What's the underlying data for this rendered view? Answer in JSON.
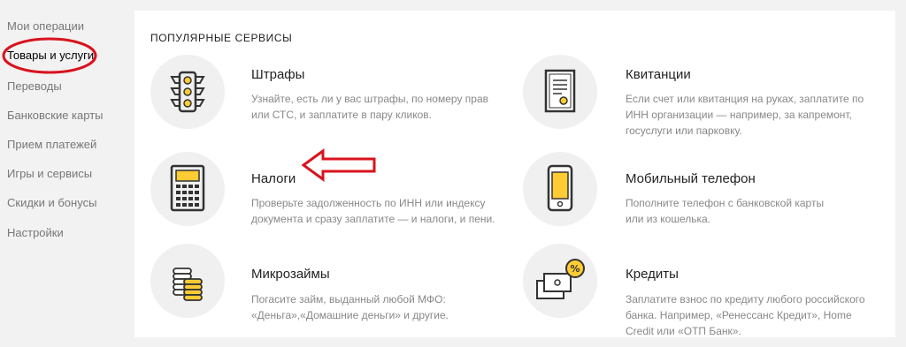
{
  "sidebar": {
    "items": [
      {
        "label": "Мои операции"
      },
      {
        "label": "Товары и услуги"
      },
      {
        "label": "Переводы"
      },
      {
        "label": "Банковские карты"
      },
      {
        "label": "Прием платежей"
      },
      {
        "label": "Игры и сервисы"
      },
      {
        "label": "Скидки и бонусы"
      },
      {
        "label": "Настройки"
      }
    ]
  },
  "main": {
    "section_title": "ПОПУЛЯРНЫЕ СЕРВИСЫ",
    "services": [
      {
        "title": "Штрафы",
        "icon": "traffic-light-icon",
        "desc": [
          "Узнайте, есть ли у вас штрафы, по номеру прав",
          "или СТС, и заплатите в пару кликов."
        ]
      },
      {
        "title": "Квитанции",
        "icon": "receipt-document-icon",
        "desc": [
          "Если счет или квитанция на руках, заплатите по",
          "ИНН организации — например, за капремонт,",
          "госуслуги или парковку."
        ]
      },
      {
        "title": "Налоги",
        "icon": "calculator-icon",
        "desc": [
          "Проверьте задолженность по ИНН или индексу",
          "документа и сразу заплатите — и налоги, и пени."
        ]
      },
      {
        "title": "Мобильный телефон",
        "icon": "mobile-phone-icon",
        "desc": [
          "Пополните телефон с банковской карты",
          "или из кошелька."
        ]
      },
      {
        "title": "Микрозаймы",
        "icon": "coin-stack-icon",
        "desc": [
          "Погасите займ, выданный любой МФО:",
          "«Деньга»,«Домашние деньги» и другие."
        ]
      },
      {
        "title": "Кредиты",
        "icon": "credit-percent-icon",
        "desc": [
          "Заплатите взнос по кредиту любого российского",
          "банка. Например, «Ренессанс Кредит», Home",
          "Credit или «ОТП Банк»."
        ]
      }
    ]
  },
  "annotations": {
    "highlight_color": "#d9131e",
    "accent_color": "#ffcc33",
    "icon_color": "#333333"
  }
}
